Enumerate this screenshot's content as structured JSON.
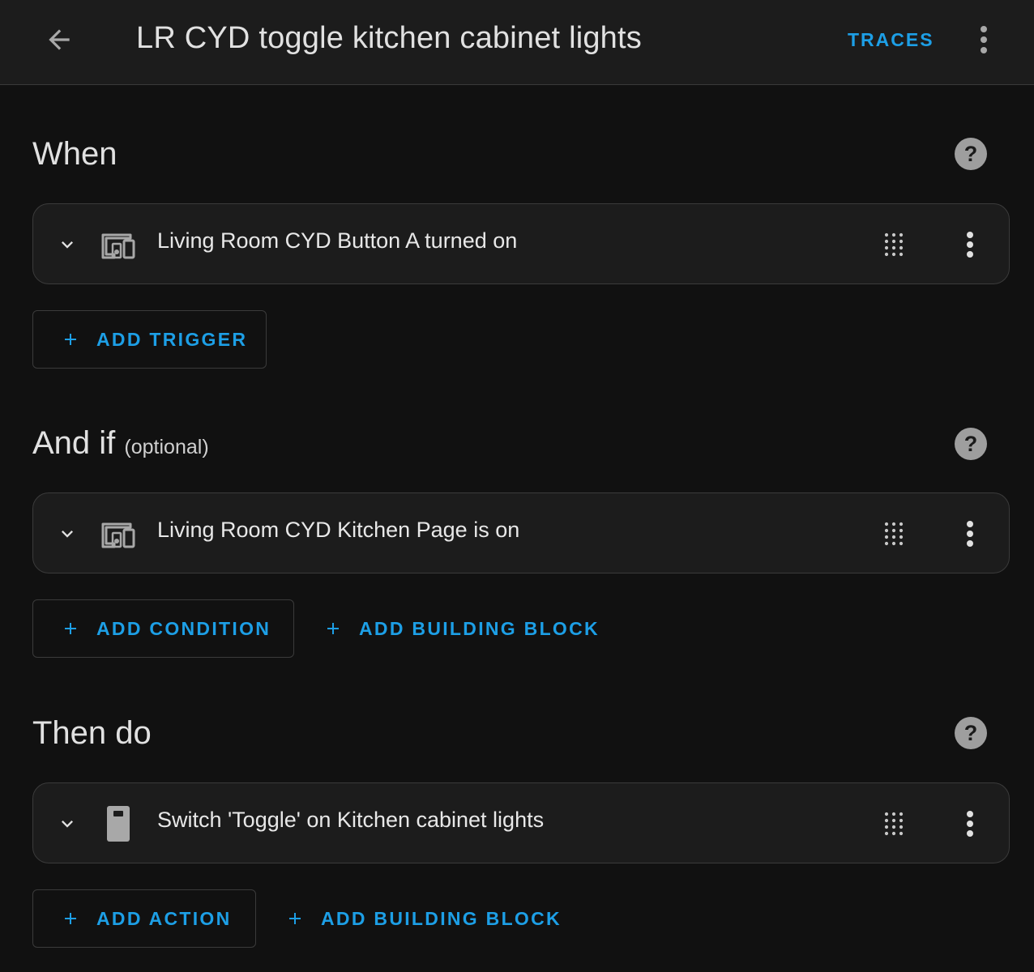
{
  "header": {
    "title": "LR CYD toggle kitchen cabinet lights",
    "traces_label": "TRACES"
  },
  "triggers": {
    "heading": "When",
    "items": [
      {
        "label": "Living Room CYD Button A turned on",
        "icon": "device-icon"
      }
    ],
    "add_label": "ADD TRIGGER"
  },
  "conditions": {
    "heading": "And if",
    "optional_label": "(optional)",
    "items": [
      {
        "label": "Living Room CYD Kitchen Page is on",
        "icon": "device-icon"
      }
    ],
    "add_label": "ADD CONDITION",
    "building_block_label": "ADD BUILDING BLOCK"
  },
  "actions": {
    "heading": "Then do",
    "items": [
      {
        "label": "Switch 'Toggle' on Kitchen cabinet lights",
        "icon": "switch-icon"
      }
    ],
    "add_label": "ADD ACTION",
    "building_block_label": "ADD BUILDING BLOCK"
  },
  "colors": {
    "background": "#111111",
    "surface": "#1c1c1c",
    "accent": "#1d9fe6",
    "text": "#e1e1e1",
    "border": "#3b3b3b"
  }
}
